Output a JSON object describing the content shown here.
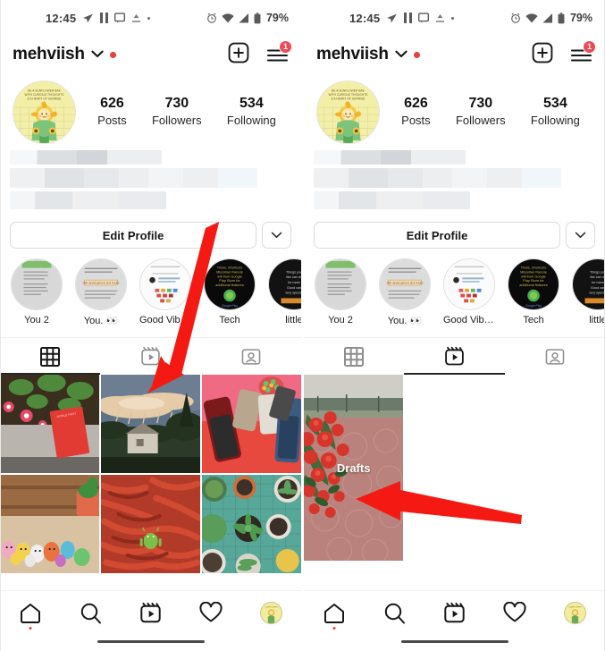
{
  "status_bar": {
    "time": "12:45",
    "battery_percent": "79%",
    "left_icons": [
      "telegram-send-icon",
      "pause-icon",
      "message-icon",
      "upload-icon",
      "dot-icon"
    ],
    "right_icons": [
      "alarm-clock-icon",
      "wifi-icon",
      "signal-icon",
      "battery-icon"
    ]
  },
  "header": {
    "username": "mehviish",
    "chevron": "chevron-down-icon",
    "status_dot_color": "#e8413f",
    "add_label": "add-post-icon",
    "menu_label": "hamburger-menu-icon",
    "menu_badge": "1",
    "badge_color": "#ed4956"
  },
  "profile": {
    "avatar_name": "profile-avatar",
    "stats": [
      {
        "number": "626",
        "label": "Posts"
      },
      {
        "number": "730",
        "label": "Followers"
      },
      {
        "number": "534",
        "label": "Following"
      }
    ],
    "bio_blurred": true
  },
  "actions": {
    "edit_profile": "Edit Profile",
    "caret": "chevron-down-icon"
  },
  "highlights": [
    {
      "label": "You 2"
    },
    {
      "label": "You. \u0001"
    },
    {
      "label": "Good Vibes O..."
    },
    {
      "label": "Tech"
    },
    {
      "label": "little"
    }
  ],
  "tabs": {
    "items": [
      {
        "name": "grid-tab",
        "icon": "grid-icon"
      },
      {
        "name": "reels-tab",
        "icon": "reels-icon"
      },
      {
        "name": "tagged-tab",
        "icon": "tagged-person-icon"
      }
    ],
    "left_active_index": 0,
    "right_active_index": 1
  },
  "left_panel": {
    "grid_cells": [
      {
        "name": "post-flowers-red-card"
      },
      {
        "name": "post-sunset-clouds"
      },
      {
        "name": "post-phones-pink-background"
      },
      {
        "name": "post-toy-figures"
      },
      {
        "name": "post-red-chillies-android"
      },
      {
        "name": "post-succulents-pots"
      }
    ]
  },
  "right_panel": {
    "drafts_label": "Drafts",
    "drafts_thumb": "drafts-thumbnail-red-flowers"
  },
  "bottom_nav": [
    {
      "name": "nav-home",
      "icon": "home-icon",
      "dot": true
    },
    {
      "name": "nav-search",
      "icon": "search-icon",
      "dot": false
    },
    {
      "name": "nav-reels",
      "icon": "reels-icon",
      "dot": false
    },
    {
      "name": "nav-activity",
      "icon": "heart-icon",
      "dot": false
    },
    {
      "name": "nav-profile",
      "icon": "profile-avatar-icon",
      "dot": false
    }
  ],
  "annotations": {
    "left_arrow": "red-arrow-pointing-to-reels-tab",
    "right_arrow": "red-arrow-pointing-to-drafts",
    "arrow_color": "#f41a13"
  }
}
